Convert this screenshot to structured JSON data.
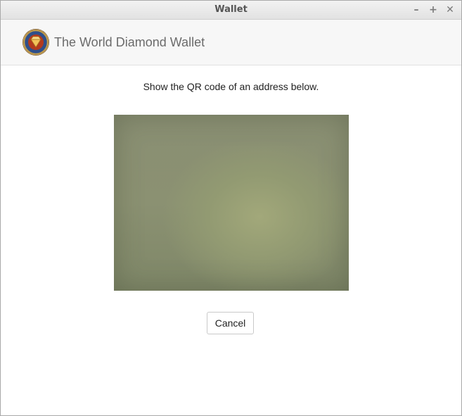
{
  "window": {
    "title": "Wallet",
    "controls": {
      "minimize": "–",
      "maximize": "+",
      "close": "✕"
    }
  },
  "header": {
    "logo_icon": "diamond-coin-logo",
    "app_name": "The World Diamond Wallet"
  },
  "main": {
    "prompt": "Show the QR code of an address below.",
    "cancel_label": "Cancel"
  }
}
